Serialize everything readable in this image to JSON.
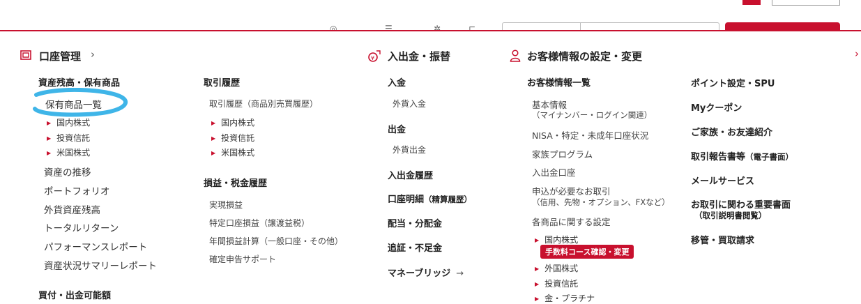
{
  "account": {
    "title": "口座管理",
    "chevron": "›",
    "col1": {
      "heading": "資産残高・保有商品",
      "highlighted": "保有商品一覧",
      "holdings_sub": [
        "国内株式",
        "投資信託",
        "米国株式"
      ],
      "items": [
        "資産の推移",
        "ポートフォリオ",
        "外貨資産残高",
        "トータルリターン",
        "パフォーマンスレポート",
        "資産状況サマリーレポート"
      ],
      "footer_heading": "買付・出金可能額"
    },
    "col2": {
      "heading": "取引履歴",
      "history_item": "取引履歴（商品別売買履歴）",
      "history_sub": [
        "国内株式",
        "投資信託",
        "米国株式"
      ],
      "tax_heading": "損益・税金履歴",
      "tax_items": [
        "実現損益",
        "特定口座損益（譲渡益税）",
        "年間損益計算（一般口座・その他）",
        "確定申告サポート"
      ]
    }
  },
  "transfer": {
    "title": "入出金・振替",
    "deposit": "入金",
    "fx_deposit": "外貨入金",
    "withdraw": "出金",
    "fx_withdraw": "外貨出金",
    "history": "入出金履歴",
    "statement": "口座明細",
    "statement_note": "（精算履歴）",
    "dividend": "配当・分配金",
    "margin": "追証・不足金",
    "money_bridge": "マネーブリッジ",
    "money_bridge_arrow": "→"
  },
  "customer": {
    "title": "お客様情報の設定・変更",
    "heading": "お客様情報一覧",
    "basic_info": "基本情報",
    "basic_info_note": "（マイナンバー・ログイン関連）",
    "nisa": "NISA・特定・未成年口座状況",
    "family": "家族プログラム",
    "bank_account": "入出金口座",
    "apply": "申込が必要なお取引",
    "apply_note": "（信用、先物・オプション、FXなど）",
    "product_settings": "各商品に関する設定",
    "domestic": "国内株式",
    "fee_badge": "手数料コース確認・変更",
    "product_sub": [
      "外国株式",
      "投資信託",
      "金・プラチナ"
    ],
    "right_items": [
      "ポイント設定・SPU",
      "Myクーポン",
      "ご家族・お友達紹介"
    ],
    "report": "取引報告書等",
    "report_note": "（電子書面）",
    "mail": "メールサービス",
    "docs": "お取引に関わる重要書面",
    "docs_note": "（取引説明書閲覧）",
    "transfer_req": "移管・買取請求"
  },
  "colors": {
    "accent": "#c8102e",
    "highlight": "#3fb5e8"
  },
  "icons": {
    "account": "account-book-icon",
    "transfer": "yen-transfer-icon",
    "customer": "person-icon",
    "next": "chevron-right-icon"
  }
}
